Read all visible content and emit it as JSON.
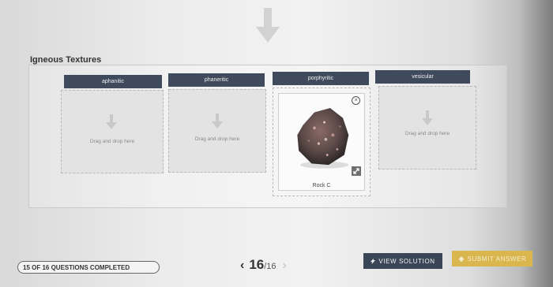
{
  "section": {
    "title": "Igneous Textures"
  },
  "columns": [
    {
      "header": "aphanitic",
      "drop_hint": "Drag and drop here"
    },
    {
      "header": "phaneritic",
      "drop_hint": "Drag and drop here"
    },
    {
      "header": "porphyritic",
      "card_label": "Rock C"
    },
    {
      "header": "vesicular",
      "drop_hint": "Drag and drop here"
    }
  ],
  "footer": {
    "progress_text": "15 OF 16 QUESTIONS COMPLETED",
    "page_current": "16",
    "page_total": "/16",
    "view_solution_label": "VIEW SOLUTION",
    "submit_label": "SUBMIT ANSWER"
  },
  "colors": {
    "header_bg": "#3f4a5c",
    "view_solution_bg": "#3a4658",
    "submit_bg": "#d9b64e"
  },
  "icons": [
    "down-arrow-icon",
    "remove-circle-icon",
    "expand-icon",
    "bolt-icon",
    "upload-icon",
    "chevron-left-icon",
    "chevron-right-icon"
  ]
}
